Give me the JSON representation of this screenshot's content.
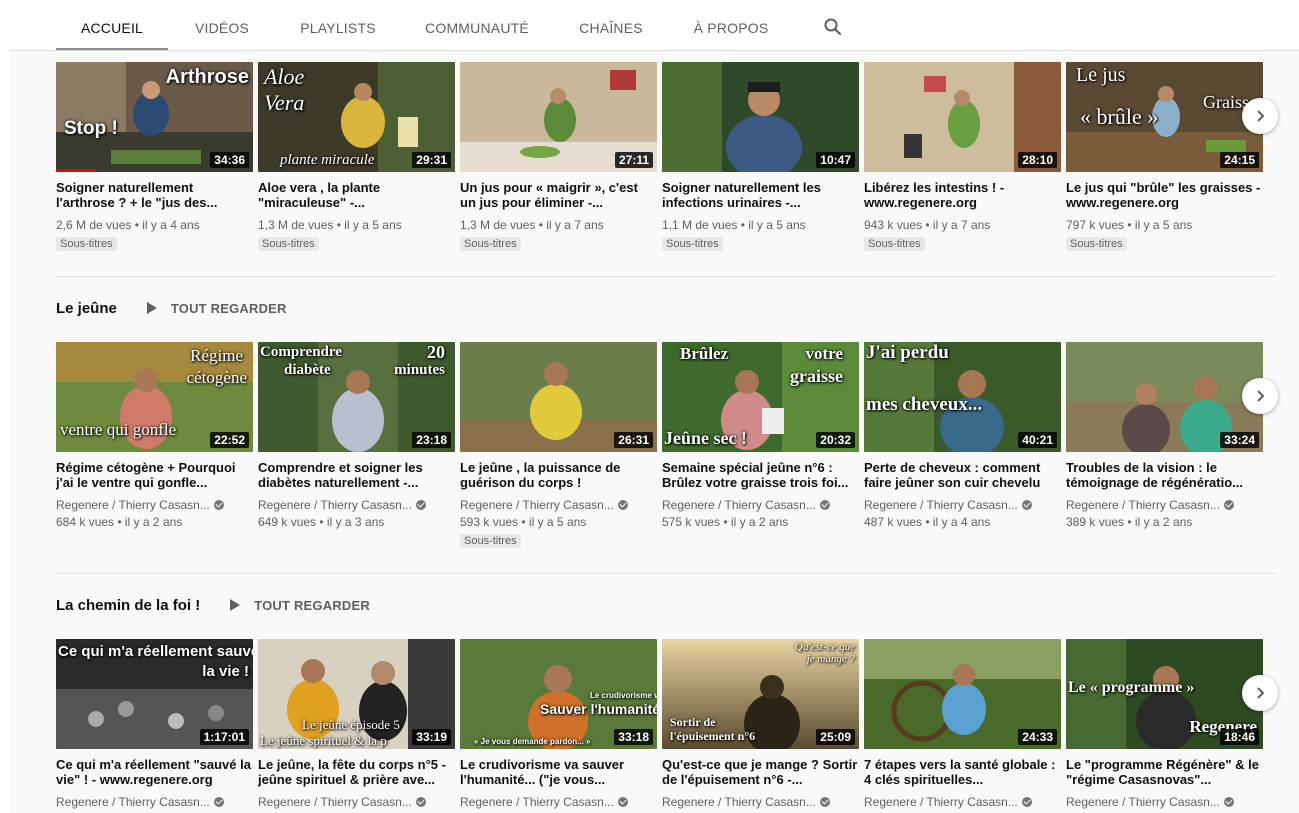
{
  "tabs": [
    {
      "label": "ACCUEIL",
      "active": true
    },
    {
      "label": "VIDÉOS"
    },
    {
      "label": "PLAYLISTS"
    },
    {
      "label": "COMMUNAUTÉ"
    },
    {
      "label": "CHAÎNES"
    },
    {
      "label": "À PROPOS"
    }
  ],
  "icons": {
    "search": "search-icon",
    "next": "chevron-right-icon",
    "play": "play-icon",
    "verified": "verified-check-icon"
  },
  "rows": [
    {
      "videos": [
        {
          "thumb_text": [
            "Arthrose",
            "Stop !"
          ],
          "duration": "34:36",
          "title": "Soigner naturellement l'arthrose ? + le \"jus des...",
          "views": "2,6 M de vues",
          "age": "il y a 4 ans",
          "badge": "Sous-titres"
        },
        {
          "thumb_text": [
            "Aloe",
            "Vera",
            "plante miracule"
          ],
          "duration": "29:31",
          "title": "Aloe vera , la plante \"miraculeuse\" -...",
          "views": "1,3 M de vues",
          "age": "il y a 5 ans",
          "badge": "Sous-titres"
        },
        {
          "thumb_text": [],
          "duration": "27:11",
          "title": "Un jus pour « maigrir », c'est un jus pour éliminer -...",
          "views": "1,3 M de vues",
          "age": "il y a 7 ans",
          "badge": "Sous-titres"
        },
        {
          "thumb_text": [],
          "duration": "10:47",
          "title": "Soigner naturellement les infections urinaires -...",
          "views": "1,1 M de vues",
          "age": "il y a 5 ans",
          "badge": "Sous-titres"
        },
        {
          "thumb_text": [],
          "duration": "28:10",
          "title": "Libérez les intestins ! - www.regenere.org",
          "views": "943 k vues",
          "age": "il y a 7 ans",
          "badge": "Sous-titres"
        },
        {
          "thumb_text": [
            "Le jus",
            "Graiss",
            "« brûle »"
          ],
          "duration": "24:15",
          "title": "Le jus qui \"brûle\" les graisses - www.regenere.org",
          "views": "797 k vues",
          "age": "il y a 5 ans",
          "badge": "Sous-titres"
        }
      ]
    },
    {
      "shelf_title": "Le jeûne",
      "play_all": "TOUT REGARDER",
      "videos": [
        {
          "thumb_text": [
            "Régime",
            "cétogène",
            "ventre qui gonfle"
          ],
          "duration": "22:52",
          "title": "Régime cétogène + Pourquoi j'ai le ventre qui gonfle...",
          "channel": "Regenere / Thierry Casasn...",
          "views": "684 k vues",
          "age": "il y a 2 ans"
        },
        {
          "thumb_text": [
            "Comprendre",
            "20",
            "diabète",
            "minutes"
          ],
          "duration": "23:18",
          "title": "Comprendre et soigner les diabètes naturellement -...",
          "channel": "Regenere / Thierry Casasn...",
          "views": "649 k vues",
          "age": "il y a 3 ans"
        },
        {
          "thumb_text": [],
          "duration": "26:31",
          "title": "Le jeûne , la puissance de guérison du corps !",
          "channel": "Regenere / Thierry Casasn...",
          "views": "593 k vues",
          "age": "il y a 5 ans",
          "badge": "Sous-titres"
        },
        {
          "thumb_text": [
            "Brûlez",
            "votre",
            "graisse",
            "Jeûne sec !"
          ],
          "duration": "20:32",
          "title": "Semaine spécial jeûne n°6 : Brûlez votre graisse trois foi...",
          "channel": "Regenere / Thierry Casasn...",
          "views": "575 k vues",
          "age": "il y a 2 ans"
        },
        {
          "thumb_text": [
            "J'ai perdu",
            "mes cheveux..."
          ],
          "duration": "40:21",
          "title": "Perte de cheveux : comment faire jeûner son cuir chevelu",
          "channel": "Regenere / Thierry Casasn...",
          "views": "487 k vues",
          "age": "il y a 4 ans"
        },
        {
          "thumb_text": [],
          "duration": "33:24",
          "title": "Troubles de la vision : le témoignage de régénératio...",
          "channel": "Regenere / Thierry Casasn...",
          "views": "389 k vues",
          "age": "il y a 2 ans"
        }
      ]
    },
    {
      "shelf_title": "La chemin de la foi !",
      "play_all": "TOUT REGARDER",
      "videos": [
        {
          "thumb_text": [
            "Ce qui m'a réellement sauvé",
            "la vie !"
          ],
          "duration": "1:17:01",
          "title": "Ce qui m'a réellement \"sauvé la vie\" ! - www.regenere.org",
          "channel": "Regenere / Thierry Casasn..."
        },
        {
          "thumb_text": [
            "Le jeûne épisode 5",
            "Le jeûne spirituel & la p"
          ],
          "duration": "33:19",
          "title": "Le jeûne, la fête du corps n°5 - jeûne spirituel & prière ave...",
          "channel": "Regenere / Thierry Casasn..."
        },
        {
          "thumb_text": [
            "Le crudivorisme va",
            "Sauver l'humanité",
            "« Je vous demande pardon... »"
          ],
          "duration": "33:18",
          "title": "Le crudivorisme va sauver l'humanité... (\"je vous...",
          "channel": "Regenere / Thierry Casasn..."
        },
        {
          "thumb_text": [
            "Qu'est-ce que",
            "je mange ?",
            "Sortir de",
            "l'épuisement n°6"
          ],
          "duration": "25:09",
          "title": "Qu'est-ce que je mange ? Sortir de l'épuisement n°6 -...",
          "channel": "Regenere / Thierry Casasn..."
        },
        {
          "thumb_text": [],
          "duration": "24:33",
          "title": "7 étapes vers la santé globale : 4 clés spirituelles...",
          "channel": "Regenere / Thierry Casasn..."
        },
        {
          "thumb_text": [
            "Le « programme »",
            "Regenere"
          ],
          "duration": "18:46",
          "title": "Le \"programme Régénère\" & le \"régime Casasnovas\"...",
          "channel": "Regenere / Thierry Casasn..."
        }
      ]
    }
  ]
}
